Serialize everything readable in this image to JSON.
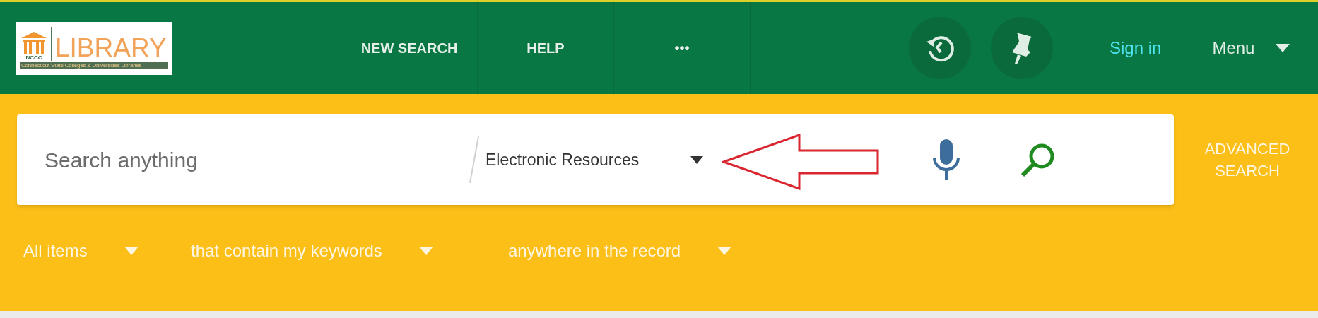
{
  "logo": {
    "badge": "NCCC",
    "title": "LIBRARY",
    "subtitle": "Connecticut State Colleges & Universities Libraries"
  },
  "nav": [
    {
      "label": "NEW SEARCH"
    },
    {
      "label": "HELP"
    },
    {
      "label": "•••"
    }
  ],
  "user": {
    "sign_in": "Sign in",
    "menu": "Menu"
  },
  "search": {
    "placeholder": "Search anything",
    "scope": "Electronic Resources",
    "advanced": "ADVANCED SEARCH"
  },
  "filters": [
    {
      "value": "All items"
    },
    {
      "value": "that contain my keywords"
    },
    {
      "value": "anywhere in the record"
    }
  ]
}
